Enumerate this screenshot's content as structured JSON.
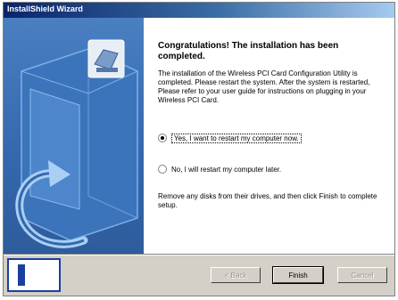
{
  "window": {
    "title": "InstallShield Wizard"
  },
  "content": {
    "heading": "Congratulations! The installation has been completed.",
    "paragraph1": "The installation of the Wireless PCI Card Configuration Utility is completed. Please restart the system. After the system is restarted, Please refer to your user guide for instructions on plugging in your Wireless PCI Card.",
    "options": [
      {
        "label": "Yes, I want to restart my computer now.",
        "selected": true
      },
      {
        "label": "No, I will restart my computer later.",
        "selected": false
      }
    ],
    "paragraph2": "Remove any disks from their drives, and then click Finish to complete setup."
  },
  "buttons": {
    "back": "< Back",
    "finish": "Finish",
    "cancel": "Cancel"
  },
  "colors": {
    "titlebar": "#0a246a",
    "side_panel": "#3467ad",
    "marker": "#1a3fa0"
  },
  "icons": {
    "side_art": "computer-setup-graphic",
    "marker": "annotation-marker-icon"
  }
}
